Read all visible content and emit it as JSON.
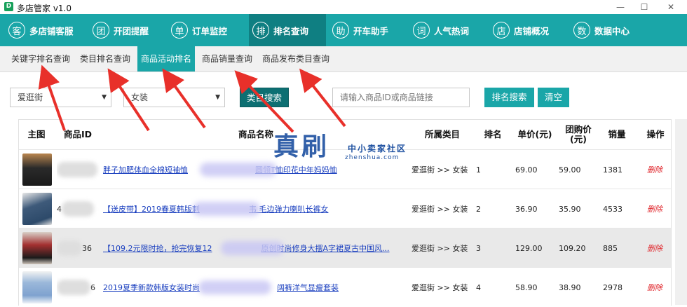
{
  "window": {
    "title": "多店管家 v1.0",
    "minimize": "—",
    "maximize": "☐",
    "close": "✕"
  },
  "main_nav": [
    {
      "icon_char": "客",
      "icon": "customer-icon",
      "label": "多店铺客服"
    },
    {
      "icon_char": "团",
      "icon": "group-icon",
      "label": "开团提醒"
    },
    {
      "icon_char": "单",
      "icon": "order-icon",
      "label": "订单监控"
    },
    {
      "icon_char": "排",
      "icon": "ranking-icon",
      "label": "排名查询"
    },
    {
      "icon_char": "助",
      "icon": "helper-icon",
      "label": "开车助手"
    },
    {
      "icon_char": "词",
      "icon": "keyword-icon",
      "label": "人气热词"
    },
    {
      "icon_char": "店",
      "icon": "shop-icon",
      "label": "店铺概况"
    },
    {
      "icon_char": "数",
      "icon": "data-icon",
      "label": "数据中心"
    }
  ],
  "sub_tabs": [
    "关键字排名查询",
    "类目排名查询",
    "商品活动排名",
    "商品销量查询",
    "商品发布类目查询"
  ],
  "filters": {
    "platform": "爱逛街",
    "category": "女装",
    "category_search_btn": "类目搜索",
    "search_placeholder": "请输入商品ID或商品链接",
    "rank_search_btn": "排名搜索",
    "clear_btn": "清空"
  },
  "table": {
    "headers": [
      "主图",
      "商品ID",
      "商品名称",
      "所属类目",
      "排名",
      "单价(元)",
      "团购价(元)",
      "销量",
      "操作"
    ],
    "rows": [
      {
        "id": "",
        "name_a": "胖子加肥体血全棉短袖恤",
        "name_b": "圆领T恤印花中年妈妈恤",
        "category": "爱逛街 >> 女装",
        "rank": "1",
        "price": "69.00",
        "group_price": "59.00",
        "sales": "1381",
        "action": "删除"
      },
      {
        "id": "4",
        "name_a": "【送皮带】2019春夏韩版刺",
        "name_b": "韦 毛边弹力喇叭长裤女",
        "category": "爱逛街 >> 女装",
        "rank": "2",
        "price": "36.90",
        "group_price": "35.90",
        "sales": "4533",
        "action": "删除"
      },
      {
        "id": "36",
        "name_a": "【109.2元限时抢，抢完恢复12",
        "name_b": "原创时尚修身大摆A字裙夏古中国风...",
        "category": "爱逛街 >> 女装",
        "rank": "3",
        "price": "129.00",
        "group_price": "109.20",
        "sales": "885",
        "action": "删除"
      },
      {
        "id": "6",
        "name_a": "2019夏季新款韩版女装时尚",
        "name_b": "阔裤洋气显瘦套装",
        "category": "爱逛街 >> 女装",
        "rank": "4",
        "price": "58.90",
        "group_price": "38.90",
        "sales": "2978",
        "action": "删除"
      }
    ]
  },
  "watermark": {
    "main": "真刷",
    "sub": "中小卖家社区",
    "url": "zhenshua.com"
  },
  "colors": {
    "accent": "#1aa6a8",
    "accent_dark": "#0f7f82",
    "link": "#1a3fbf",
    "danger": "#e0262c",
    "arrow": "#e8302a"
  }
}
